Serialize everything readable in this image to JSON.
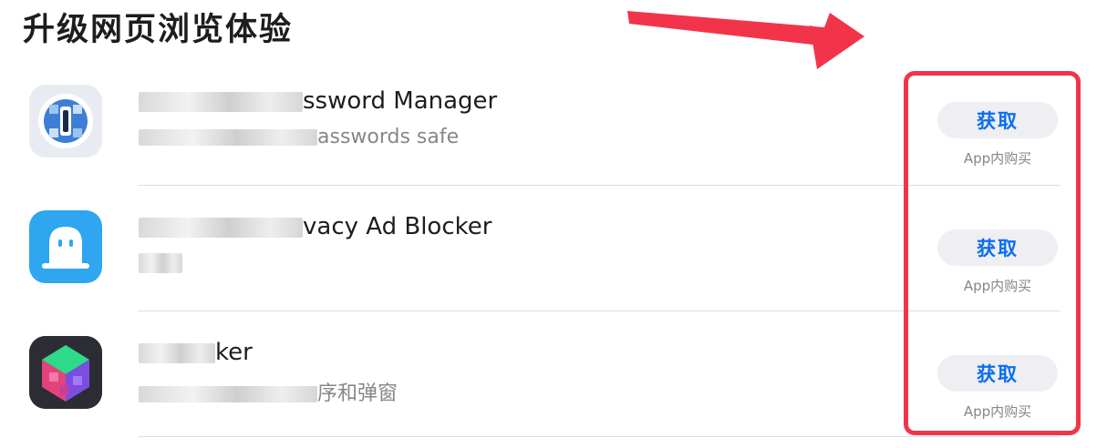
{
  "section": {
    "title": "升级网页浏览体验"
  },
  "apps": [
    {
      "name_visible": "ssword Manager",
      "subtitle_visible": "asswords safe",
      "get_label": "获取",
      "iap_label": "App内购买"
    },
    {
      "name_visible": "vacy Ad Blocker",
      "subtitle_visible": "",
      "get_label": "获取",
      "iap_label": "App内购买"
    },
    {
      "name_visible": "ker",
      "subtitle_visible": "序和弹窗",
      "get_label": "获取",
      "iap_label": "App内购买"
    }
  ],
  "colors": {
    "accent": "#0a6ff0",
    "annotation": "#f2344a"
  }
}
